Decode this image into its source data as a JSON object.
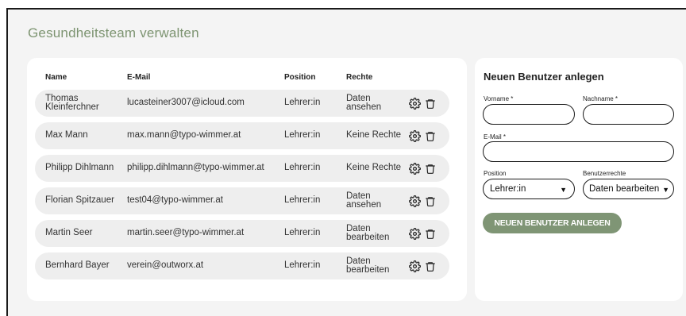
{
  "page": {
    "title": "Gesundheitsteam verwalten"
  },
  "table": {
    "headers": {
      "name": "Name",
      "email": "E-Mail",
      "position": "Position",
      "rights": "Rechte"
    },
    "rows": [
      {
        "name": "Thomas Kleinferchner",
        "email": "lucasteiner3007@icloud.com",
        "position": "Lehrer:in",
        "rights": "Daten ansehen"
      },
      {
        "name": "Max Mann",
        "email": "max.mann@typo-wimmer.at",
        "position": "Lehrer:in",
        "rights": "Keine Rechte"
      },
      {
        "name": "Philipp Dihlmann",
        "email": "philipp.dihlmann@typo-wimmer.at",
        "position": "Lehrer:in",
        "rights": "Keine Rechte"
      },
      {
        "name": "Florian Spitzauer",
        "email": "test04@typo-wimmer.at",
        "position": "Lehrer:in",
        "rights": "Daten ansehen"
      },
      {
        "name": "Martin Seer",
        "email": "martin.seer@typo-wimmer.at",
        "position": "Lehrer:in",
        "rights": "Daten bearbeiten"
      },
      {
        "name": "Bernhard Bayer",
        "email": "verein@outworx.at",
        "position": "Lehrer:in",
        "rights": "Daten bearbeiten"
      }
    ],
    "row_icons": [
      "gear-icon",
      "trash-icon"
    ]
  },
  "form": {
    "title": "Neuen Benutzer anlegen",
    "firstname_label": "Vorname *",
    "lastname_label": "Nachname *",
    "email_label": "E-Mail *",
    "position_label": "Position",
    "rights_label": "Benutzerrechte",
    "position_value": "Lehrer:in",
    "rights_value": "Daten bearbeiten",
    "submit_label": "NEUEN BENUTZER ANLEGEN"
  },
  "colors": {
    "accent": "#7f9575",
    "title": "#7d9471",
    "row_bg": "#eeeeee",
    "page_bg": "#f4f4f4"
  }
}
